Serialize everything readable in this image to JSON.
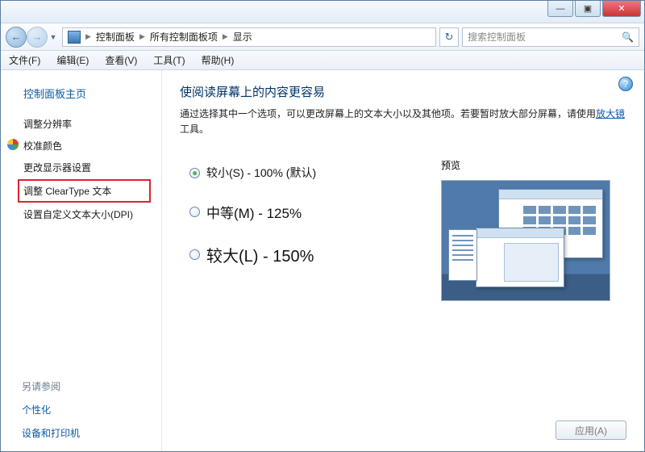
{
  "titlebar": {
    "min": "—",
    "max": "▣",
    "close": "✕"
  },
  "nav": {
    "back": "←",
    "fwd": "→",
    "drop": "▼",
    "crumbs": [
      "控制面板",
      "所有控制面板项",
      "显示"
    ],
    "refresh": "↻",
    "search_placeholder": "搜索控制面板"
  },
  "menu": {
    "file": "文件(F)",
    "edit": "编辑(E)",
    "view": "查看(V)",
    "tools": "工具(T)",
    "help": "帮助(H)"
  },
  "sidebar": {
    "home": "控制面板主页",
    "items": [
      "调整分辨率",
      "校准颜色",
      "更改显示器设置",
      "调整 ClearType 文本",
      "设置自定义文本大小(DPI)"
    ],
    "see_also": "另请参阅",
    "personalization": "个性化",
    "devices": "设备和打印机"
  },
  "main": {
    "help": "?",
    "heading": "使阅读屏幕上的内容更容易",
    "desc_pre": "通过选择其中一个选项，可以更改屏幕上的文本大小以及其他项。若要暂时放大部分屏幕，请使用",
    "desc_link": "放大镜",
    "desc_post": "工具。",
    "opt_small": "较小(S) - 100% (默认)",
    "opt_medium": "中等(M) - 125%",
    "opt_large": "较大(L) - 150%",
    "preview": "预览",
    "apply": "应用(A)"
  }
}
